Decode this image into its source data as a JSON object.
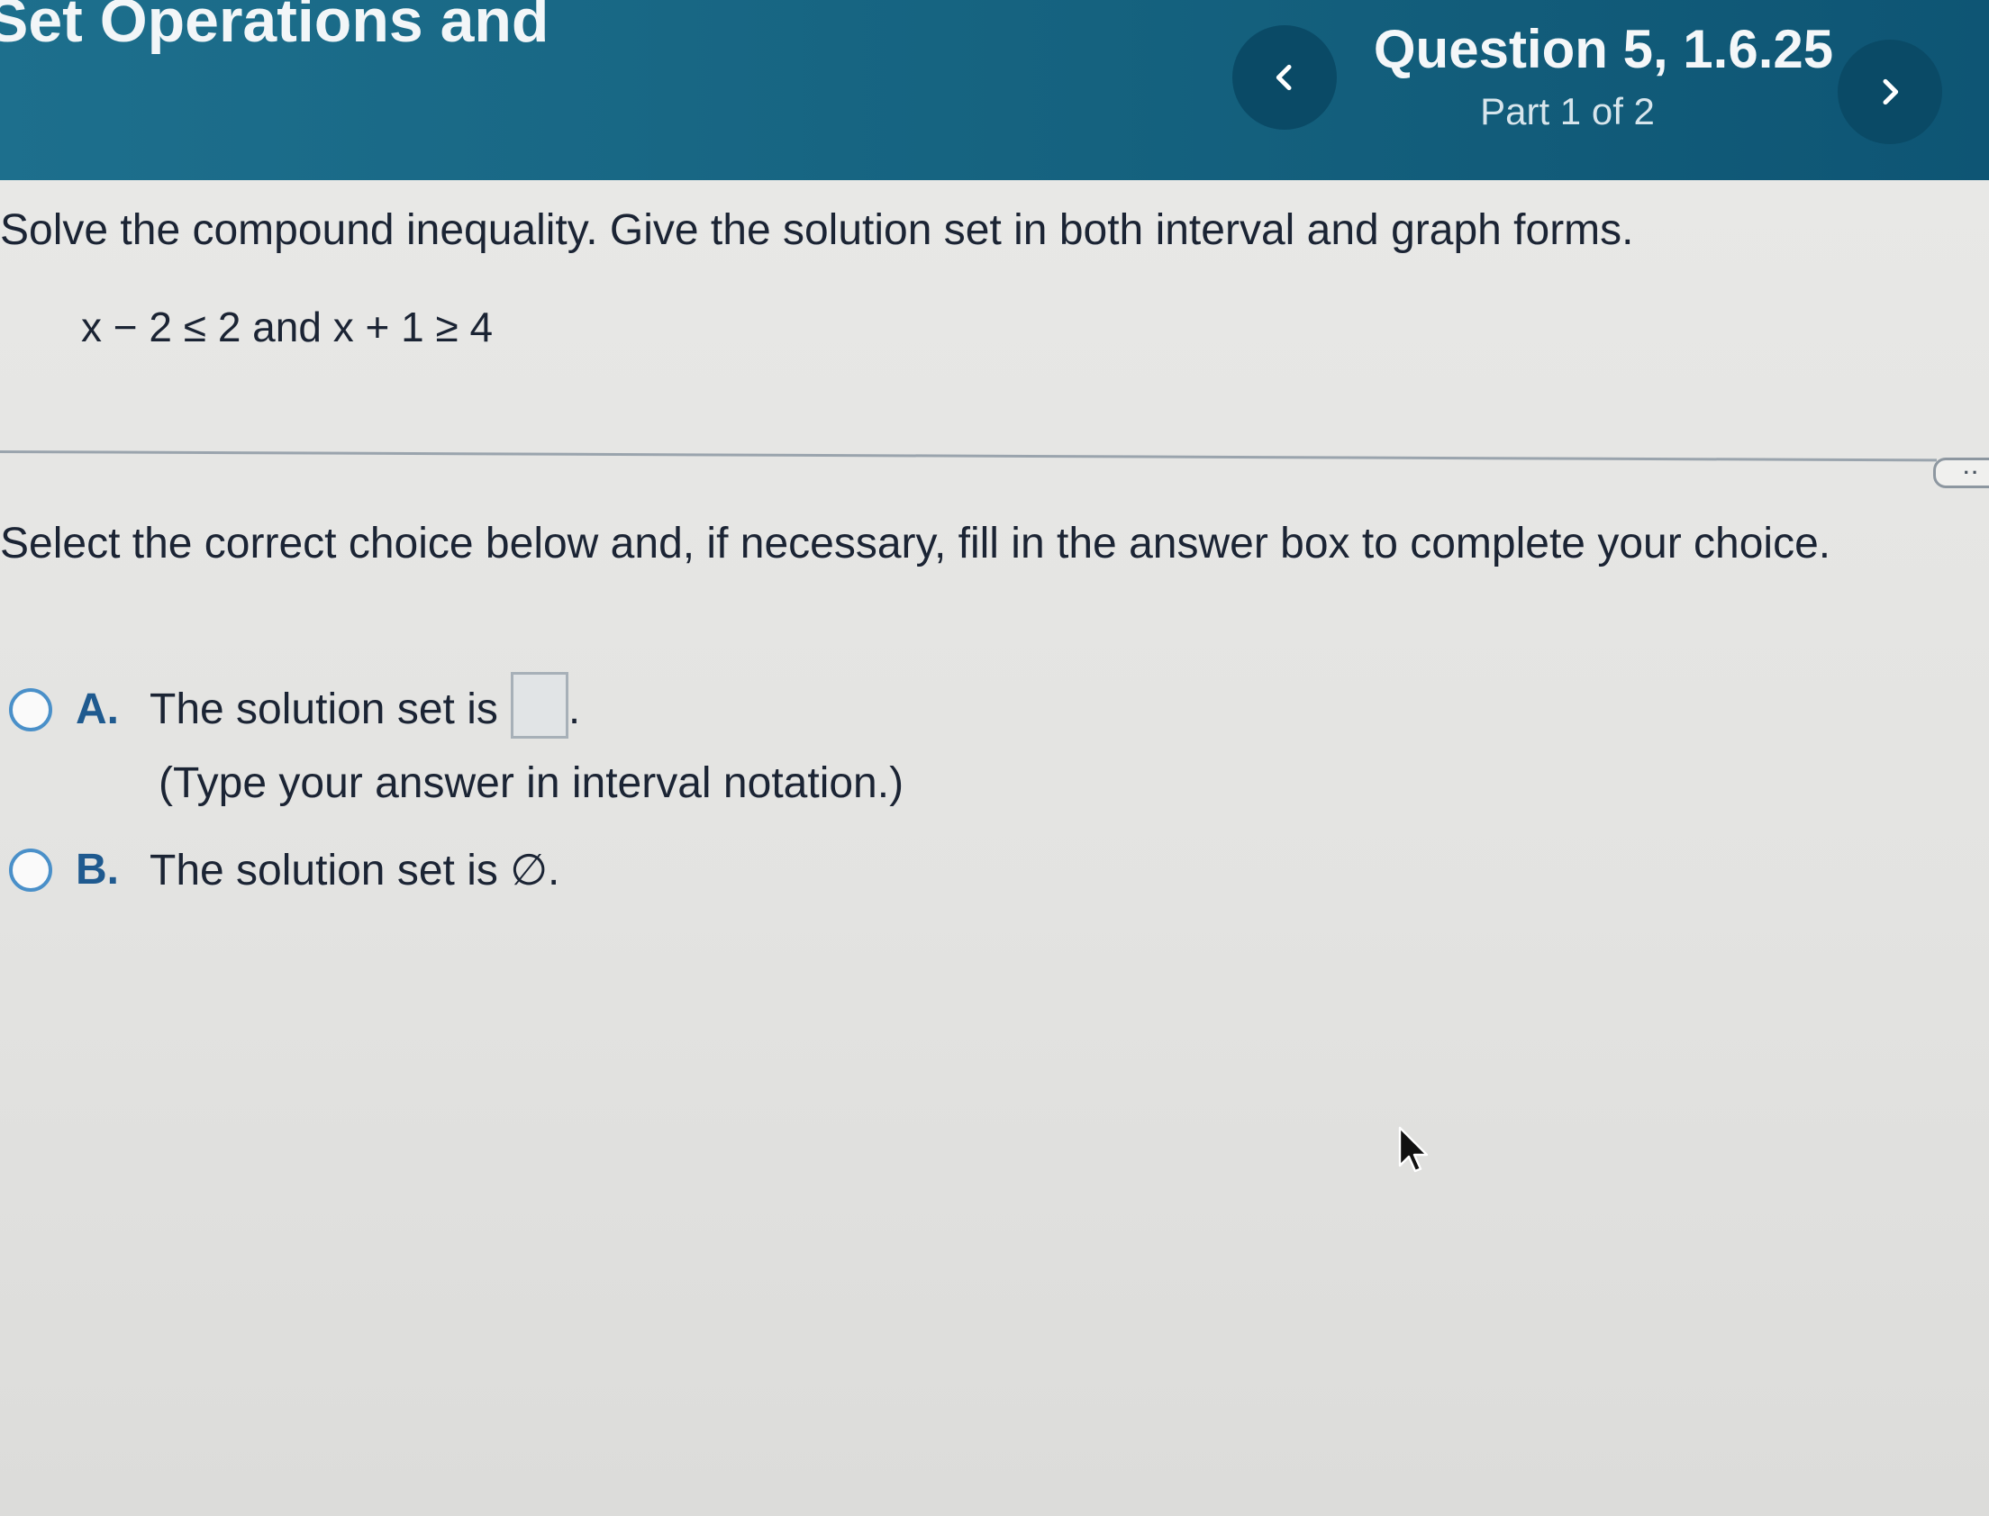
{
  "header": {
    "section_title": "Set Operations and",
    "question_title": "Question 5, 1.6.25",
    "question_part": "Part 1 of 2",
    "prev_icon": "chevron-left-icon",
    "next_icon": "chevron-right-icon"
  },
  "problem": {
    "instructions": "Solve the compound inequality. Give the solution set in both interval and graph forms.",
    "inequality": "x − 2 ≤ 2 and x + 1 ≥ 4"
  },
  "expand_handle": "··",
  "answer": {
    "prompt": "Select the correct choice below and, if necessary, fill in the answer box to complete your choice.",
    "choice_a": {
      "letter": "A.",
      "text": "The solution set is",
      "suffix": ".",
      "hint": "(Type your answer in interval notation.)"
    },
    "choice_b": {
      "letter": "B.",
      "text": "The solution set is ∅."
    }
  },
  "colors": {
    "header_bg": "#15627f",
    "nav_button": "#0a4a66",
    "choice_letter": "#1f5a8f",
    "radio_border": "#4a90c9"
  }
}
